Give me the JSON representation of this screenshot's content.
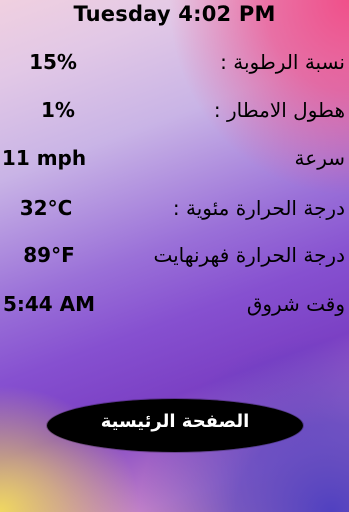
{
  "header": {
    "datetime": "Tuesday 4:02 PM"
  },
  "rows": [
    {
      "label": "نسبة الرطوبة :",
      "value": "15%"
    },
    {
      "label": "هطول الامطار :",
      "value": "1%"
    },
    {
      "label": "سرعة",
      "value": "11 mph"
    },
    {
      "label": "درجة الحرارة مئوية :",
      "value": "32°C"
    },
    {
      "label": "درجة الحرارة فهرنهايت",
      "value": "89°F"
    },
    {
      "label": "وقت شروق",
      "value": "5:44 AM"
    }
  ],
  "home_button": {
    "label": "الصفحة الرئيسية"
  },
  "colors": {
    "text": "#000000",
    "button_text": "#ffffff",
    "button_bg": "#000000"
  }
}
